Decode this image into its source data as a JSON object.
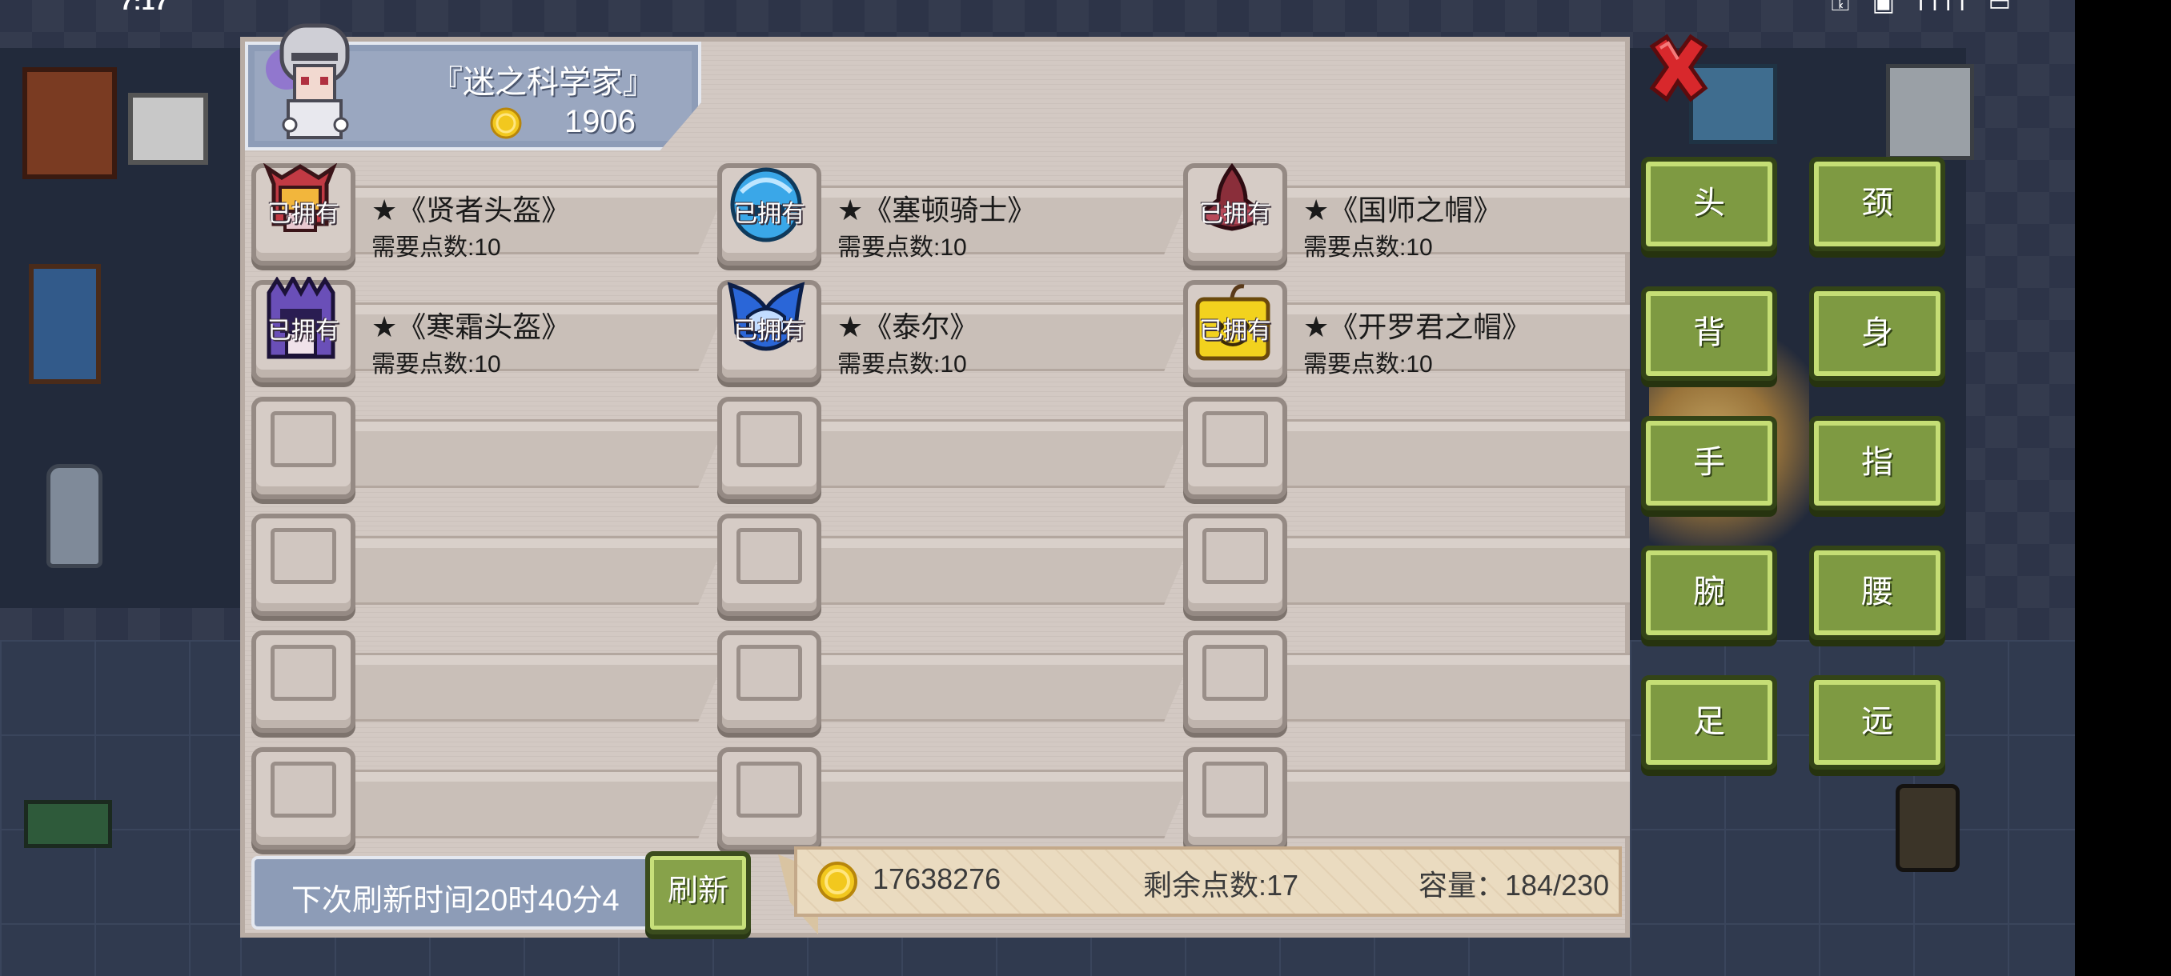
{
  "status_bar": {
    "time": "7:17",
    "icons": "⚿ ▣ ıllı ▭"
  },
  "header": {
    "title": "『迷之科学家』",
    "coins": "1906"
  },
  "close_label": "✕",
  "slots": [
    {
      "name": "★《贤者头盔》",
      "cost": "需要点数:10",
      "owned": "已拥有",
      "icon": "sage-helmet-icon"
    },
    {
      "name": "★《塞顿骑士》",
      "cost": "需要点数:10",
      "owned": "已拥有",
      "icon": "seton-knight-helmet-icon"
    },
    {
      "name": "★《国师之帽》",
      "cost": "需要点数:10",
      "owned": "已拥有",
      "icon": "imperial-advisor-hat-icon"
    },
    {
      "name": "★《寒霜头盔》",
      "cost": "需要点数:10",
      "owned": "已拥有",
      "icon": "frost-helmet-icon"
    },
    {
      "name": "★《泰尔》",
      "cost": "需要点数:10",
      "owned": "已拥有",
      "icon": "tyr-helmet-icon"
    },
    {
      "name": "★《开罗君之帽》",
      "cost": "需要点数:10",
      "owned": "已拥有",
      "icon": "kairo-hat-icon"
    }
  ],
  "empty_slot_count": 12,
  "bottom": {
    "refresh_timer": "下次刷新时间20时40分4",
    "refresh_button": "刷新",
    "total_coins": "17638276",
    "remaining_points": "剩余点数:17",
    "capacity": "容量：184/230"
  },
  "categories": [
    "头",
    "颈",
    "背",
    "身",
    "手",
    "指",
    "腕",
    "腰",
    "足",
    "远"
  ],
  "colors": {
    "panel_bg": "#d1c7c1",
    "header_plate": "#8d9cb7",
    "button_green": "#7e9a42",
    "close_red": "#d8282c",
    "coin_gold": "#f2c81e"
  }
}
